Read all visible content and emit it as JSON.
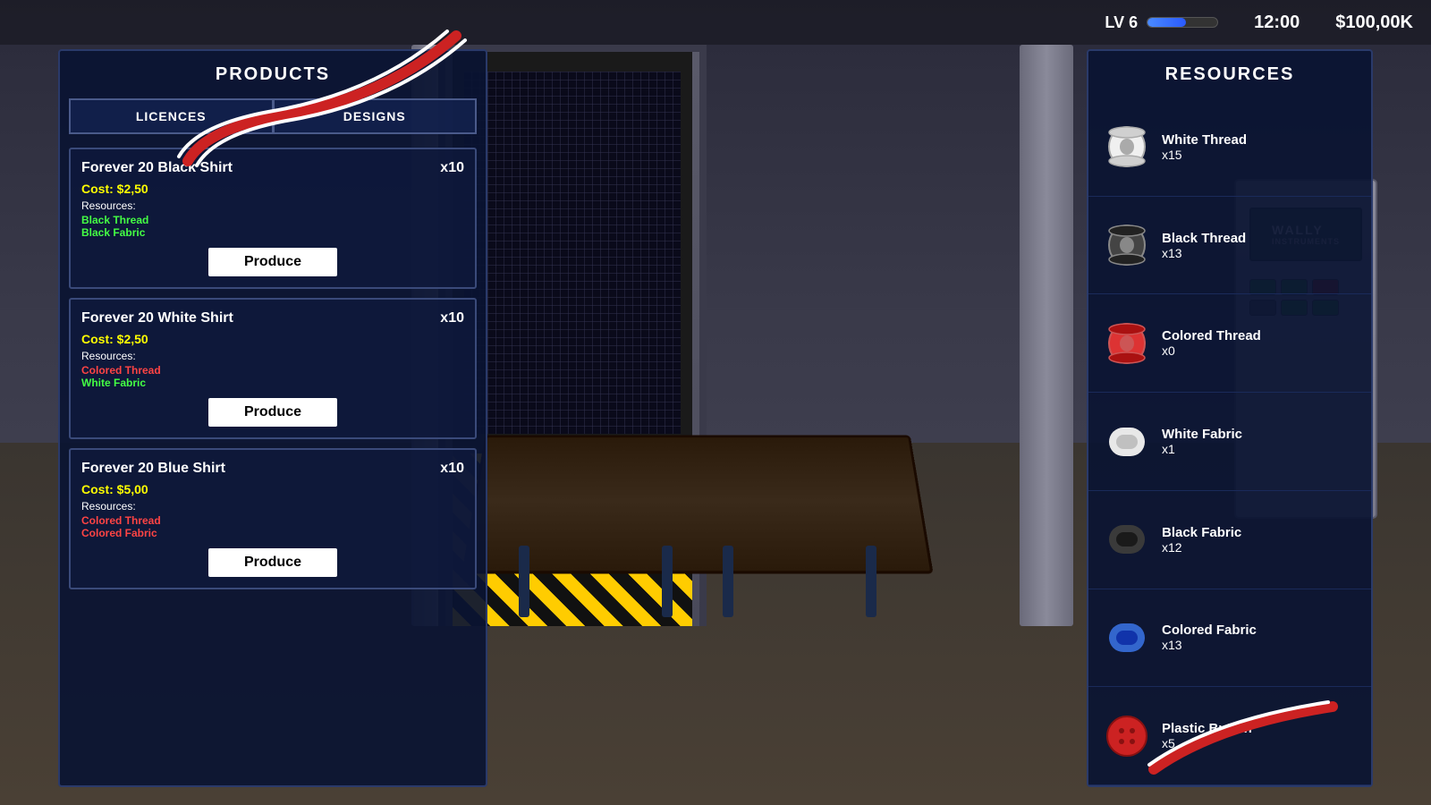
{
  "hud": {
    "level_label": "LV 6",
    "xp_percent": 55,
    "time": "12:00",
    "money": "$100,00K"
  },
  "products_panel": {
    "title": "PRODUCTS",
    "tab_licences": "LICENCES",
    "tab_designs": "DESIGNS",
    "products": [
      {
        "name": "Forever 20 Black Shirt",
        "qty": "x10",
        "cost": "Cost: $2,50",
        "resources_label": "Resources:",
        "resources": [
          {
            "name": "Black Thread",
            "color": "green"
          },
          {
            "name": "Black Fabric",
            "color": "green"
          }
        ],
        "produce_label": "Produce"
      },
      {
        "name": "Forever 20 White Shirt",
        "qty": "x10",
        "cost": "Cost: $2,50",
        "resources_label": "Resources:",
        "resources": [
          {
            "name": "Colored Thread",
            "color": "red"
          },
          {
            "name": "White Fabric",
            "color": "green"
          }
        ],
        "produce_label": "Produce"
      },
      {
        "name": "Forever 20 Blue Shirt",
        "qty": "x10",
        "cost": "Cost: $5,00",
        "resources_label": "Resources:",
        "resources": [
          {
            "name": "Colored Thread",
            "color": "red"
          },
          {
            "name": "Colored Fabric",
            "color": "red"
          }
        ],
        "produce_label": "Produce"
      }
    ]
  },
  "resources_panel": {
    "title": "RESOURCES",
    "resources": [
      {
        "name": "White Thread",
        "count": "x15",
        "icon_type": "thread-white"
      },
      {
        "name": "Black Thread",
        "count": "x13",
        "icon_type": "thread-black"
      },
      {
        "name": "Colored Thread",
        "count": "x0",
        "icon_type": "thread-colored"
      },
      {
        "name": "White Fabric",
        "count": "x1",
        "icon_type": "fabric-white"
      },
      {
        "name": "Black Fabric",
        "count": "x12",
        "icon_type": "fabric-black"
      },
      {
        "name": "Colored Fabric",
        "count": "x13",
        "icon_type": "fabric-colored"
      },
      {
        "name": "Plastic Button",
        "count": "x5",
        "icon_type": "button-plastic"
      }
    ]
  },
  "wally": {
    "brand": "WALLY",
    "sub": "INSTRUMENTS"
  }
}
